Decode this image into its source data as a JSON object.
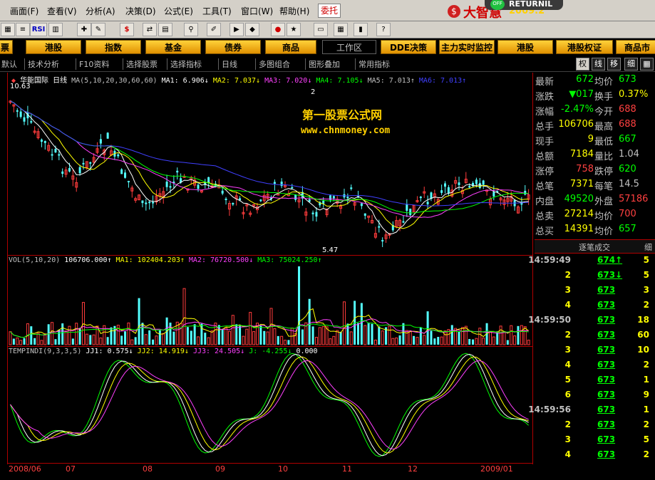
{
  "menu": {
    "items": [
      "画面(F)",
      "查看(V)",
      "分析(A)",
      "决策(D)",
      "公式(E)",
      "工具(T)",
      "窗口(W)",
      "帮助(H)"
    ],
    "commission": "委托",
    "brand": "大智慧",
    "brand_tail": "2009.2",
    "return": "RETURNIL",
    "off": "OFF"
  },
  "toolbar": {
    "rsi": "RSI"
  },
  "markets": {
    "items": [
      "港股",
      "指数",
      "基金",
      "债券",
      "商品"
    ],
    "workspace": "工作区",
    "right_items": [
      "DDE决策",
      "主力实时监控",
      "港股",
      "港股权证",
      "商品市"
    ]
  },
  "subtabs": {
    "items": [
      "默认",
      "技术分析",
      "F10资料",
      "选择股票",
      "选择指标",
      "日线",
      "多图组合",
      "图形叠加",
      "常用指标"
    ],
    "buttons": [
      "权",
      "线",
      "移",
      "细"
    ]
  },
  "chart": {
    "stock_name": "华能国际",
    "period": "日线",
    "ma_legend": {
      "label": "MA(5,10,20,30,60,60)",
      "ma1": "MA1: 6.906↓",
      "ma2": "MA2: 7.037↓",
      "ma3": "MA3: 7.020↓",
      "ma4": "MA4: 7.105↓",
      "ma5": "MA5: 7.013↑",
      "ma6": "MA6: 7.013↑"
    },
    "high_label": "10.63",
    "low_label": "5.47",
    "marker": "2",
    "watermark_title": "第一股票公式网",
    "watermark_url": "www.chnmoney.com",
    "vol_legend": {
      "label": "VOL(5,10,20)",
      "vol": "106706.000↑",
      "ma1": "MA1: 102404.203↑",
      "ma2": "MA2: 76720.500↓",
      "ma3": "MA3: 75024.250↑"
    },
    "ind_legend": {
      "label": "TEMPINDI(9,3,3,5)",
      "jj1": "JJ1: 0.575↓",
      "jj2": "JJ2: 14.919↓",
      "jj3": "JJ3: 24.505↓",
      "j": "J: -4.255↓",
      "v": "0.000"
    },
    "x_labels": [
      "2008/06",
      "07",
      "08",
      "09",
      "10",
      "11",
      "12",
      "2009/01"
    ],
    "colors": {
      "up": "#ff3c3c",
      "down": "#54ffff",
      "ma1": "#ffffff",
      "ma2": "#ffff00",
      "ma3": "#ff40ff",
      "ma4": "#00ff00",
      "ma5": "#4040ff",
      "frame": "#b00000"
    }
  },
  "quote": {
    "rows": [
      {
        "l1": "最新",
        "v1": "672",
        "l2": "均价",
        "v2": "673"
      },
      {
        "l1": "涨跌",
        "v1": "▼017",
        "l2": "换手",
        "v2": "0.37%"
      },
      {
        "l1": "涨幅",
        "v1": "-2.47%",
        "l2": "今开",
        "v2": "688"
      },
      {
        "l1": "总手",
        "v1": "106706",
        "l2": "最高",
        "v2": "688"
      },
      {
        "l1": "现手",
        "v1": "9",
        "l2": "最低",
        "v2": "667"
      },
      {
        "l1": "总额",
        "v1": "7184",
        "l2": "量比",
        "v2": "1.04"
      },
      {
        "l1": "涨停",
        "v1": "758",
        "l2": "跌停",
        "v2": "620"
      },
      {
        "l1": "总笔",
        "v1": "7371",
        "l2": "每笔",
        "v2": "14.5"
      },
      {
        "l1": "内盘",
        "v1": "49520",
        "l2": "外盘",
        "v2": "57186"
      },
      {
        "l1": "总卖",
        "v1": "27214",
        "l2": "均价",
        "v2": "700"
      },
      {
        "l1": "总买",
        "v1": "14391",
        "l2": "均价",
        "v2": "657"
      }
    ],
    "ticks_title": "逐笔成交",
    "ticks_tab": "细",
    "ticks": [
      {
        "t": "14:59:49",
        "p": "674↑",
        "v": "5"
      },
      {
        "t": "2",
        "p": "673↓",
        "v": "5"
      },
      {
        "t": "3",
        "p": "673",
        "v": "3"
      },
      {
        "t": "4",
        "p": "673",
        "v": "2"
      },
      {
        "t": "14:59:50",
        "p": "673",
        "v": "18"
      },
      {
        "t": "2",
        "p": "673",
        "v": "60"
      },
      {
        "t": "3",
        "p": "673",
        "v": "10"
      },
      {
        "t": "4",
        "p": "673",
        "v": "2"
      },
      {
        "t": "5",
        "p": "673",
        "v": "1"
      },
      {
        "t": "6",
        "p": "673",
        "v": "9"
      },
      {
        "t": "14:59:56",
        "p": "673",
        "v": "1"
      },
      {
        "t": "2",
        "p": "673",
        "v": "2"
      },
      {
        "t": "3",
        "p": "673",
        "v": "5"
      },
      {
        "t": "4",
        "p": "673",
        "v": "2"
      }
    ]
  }
}
